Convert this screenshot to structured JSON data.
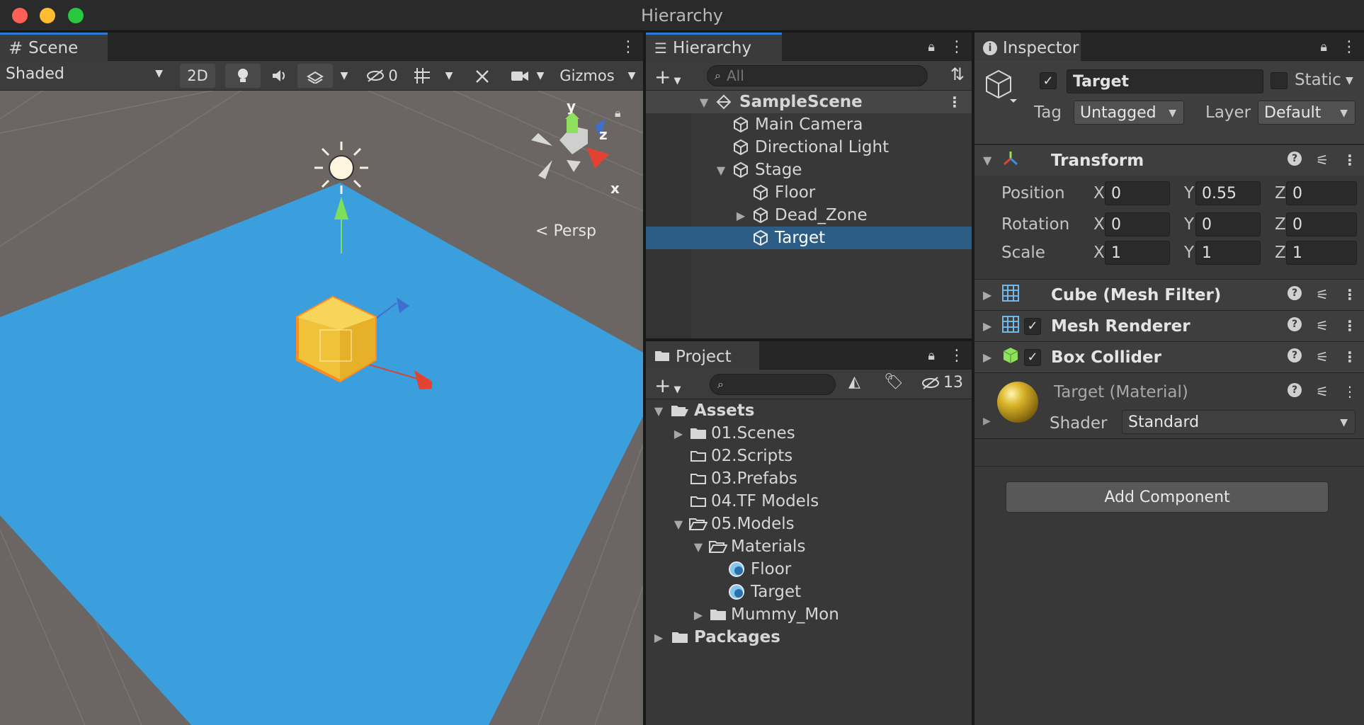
{
  "window": {
    "title": "Hierarchy"
  },
  "scene": {
    "tab_label": "Scene",
    "shading_mode": "Shaded",
    "btn_2d": "2D",
    "hidden_count": "0",
    "gizmos_label": "Gizmos",
    "projection_label": "Persp",
    "gizmo_axes": {
      "y": "y",
      "z": "z",
      "x": "x"
    }
  },
  "hierarchy": {
    "tab_label": "Hierarchy",
    "search_placeholder": "All",
    "scene_name": "SampleScene",
    "items": [
      {
        "label": "Main Camera"
      },
      {
        "label": "Directional Light"
      },
      {
        "label": "Stage"
      },
      {
        "label": "Floor"
      },
      {
        "label": "Dead_Zone"
      },
      {
        "label": "Target"
      }
    ]
  },
  "project": {
    "tab_label": "Project",
    "hidden_count": "13",
    "tree": [
      {
        "label": "Assets"
      },
      {
        "label": "01.Scenes"
      },
      {
        "label": "02.Scripts"
      },
      {
        "label": "03.Prefabs"
      },
      {
        "label": "04.TF Models"
      },
      {
        "label": "05.Models"
      },
      {
        "label": "Materials"
      },
      {
        "label": "Floor"
      },
      {
        "label": "Target"
      },
      {
        "label": "Mummy_Mon"
      },
      {
        "label": "Packages"
      }
    ]
  },
  "inspector": {
    "tab_label": "Inspector",
    "object_name": "Target",
    "static_label": "Static",
    "tag_label": "Tag",
    "tag_value": "Untagged",
    "layer_label": "Layer",
    "layer_value": "Default",
    "transform": {
      "title": "Transform",
      "position_label": "Position",
      "rotation_label": "Rotation",
      "scale_label": "Scale",
      "axis_x": "X",
      "axis_y": "Y",
      "axis_z": "Z",
      "position": {
        "x": "0",
        "y": "0.55",
        "z": "0"
      },
      "rotation": {
        "x": "0",
        "y": "0",
        "z": "0"
      },
      "scale": {
        "x": "1",
        "y": "1",
        "z": "1"
      }
    },
    "mesh_filter": {
      "title": "Cube (Mesh Filter)"
    },
    "mesh_renderer": {
      "title": "Mesh Renderer"
    },
    "box_collider": {
      "title": "Box Collider"
    },
    "material": {
      "title": "Target (Material)",
      "shader_label": "Shader",
      "shader_value": "Standard"
    },
    "add_component_label": "Add Component"
  },
  "colors": {
    "accent": "#2d7ad6",
    "selection": "#2c5d87",
    "floor_plane": "#3a9fdc",
    "ground": "#6b6663",
    "cube": "#f1c232"
  }
}
